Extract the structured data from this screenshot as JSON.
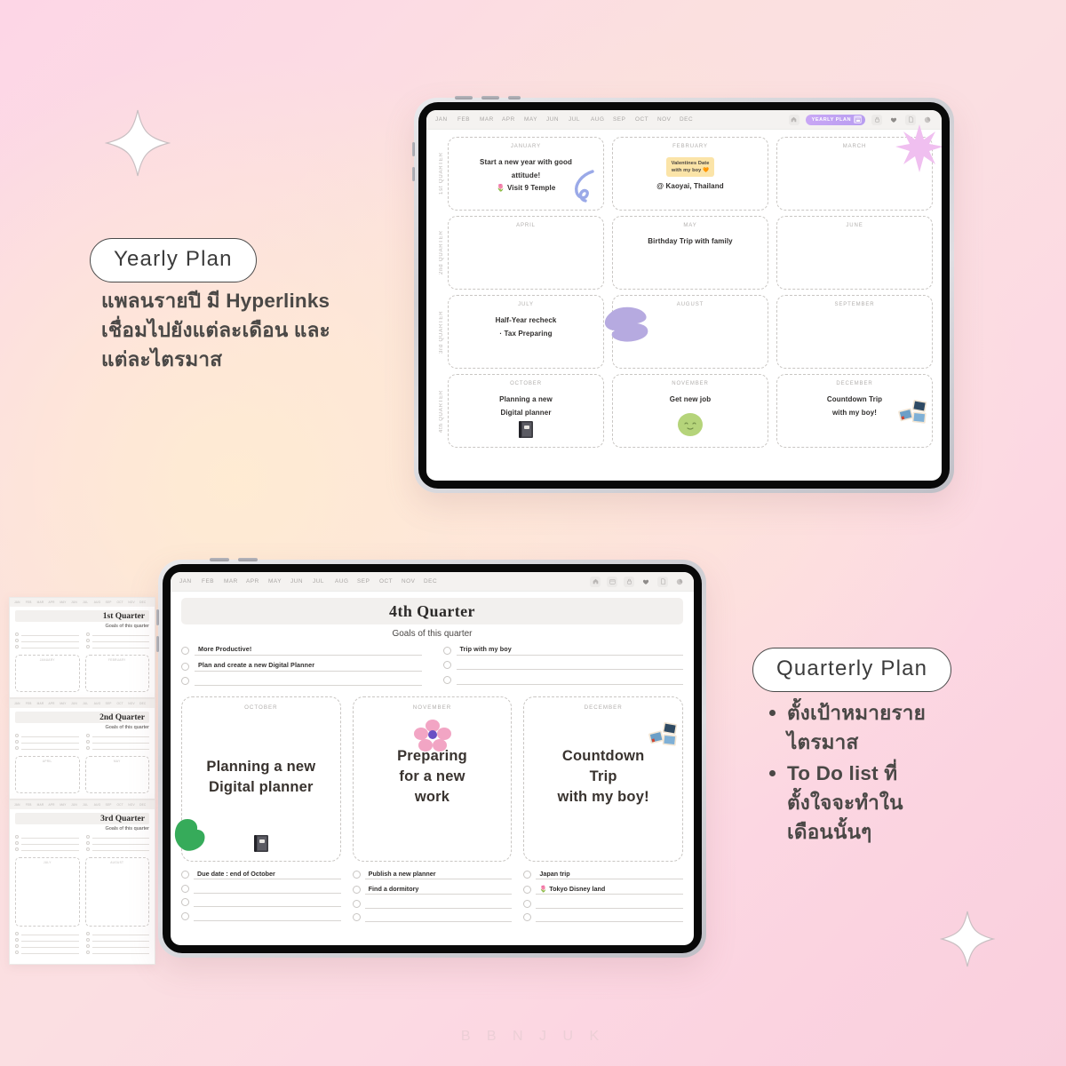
{
  "brand": {
    "footer": "B B N J U K"
  },
  "callouts": {
    "yearly": {
      "pill": "Yearly Plan",
      "line1": "แพลนรายปี มี Hyperlinks",
      "line2": "เชื่อมไปยังแต่ละเดือน และ",
      "line3": "แต่ละไตรมาส"
    },
    "quarterly": {
      "pill": "Quarterly Plan",
      "bullets": [
        "ตั้งเป้าหมายราย ไตรมาส",
        "To Do list ที่ ตั้งใจจะทำใน เดือนนั้นๆ"
      ],
      "bullet1_l1": "ตั้งเป้าหมายราย",
      "bullet1_l2": "ไตรมาส",
      "bullet2_l1": "To Do list ที่",
      "bullet2_l2": "ตั้งใจจะทำใน",
      "bullet2_l3": "เดือนนั้นๆ"
    }
  },
  "toolbar": {
    "months": [
      "JAN",
      "FEB",
      "MAR",
      "APR",
      "MAY",
      "JUN",
      "JUL",
      "AUG",
      "SEP",
      "OCT",
      "NOV",
      "DEC"
    ],
    "plan_pill_label": "YEARLY PLAN",
    "icons": [
      "home-icon",
      "calendar-icon",
      "lock-icon",
      "heart-icon",
      "note-icon",
      "pen-icon"
    ],
    "accent_purple": "#bb9cf0"
  },
  "yearly_page": {
    "quarters": [
      {
        "label": "1st QUARTER",
        "months": [
          {
            "name": "JANUARY",
            "line1": "Start a new year with good",
            "line2": "attitude!",
            "line3": "🌷 Visit 9 Temple",
            "sticker": "blue-squiggle"
          },
          {
            "name": "FEBRUARY",
            "sticky": "Valentines Date\nwith my boy 🧡",
            "place": "@ Kaoyai, Thailand"
          },
          {
            "name": "MARCH",
            "sticker": "pink-star"
          }
        ]
      },
      {
        "label": "2nd QUARTER",
        "months": [
          {
            "name": "APRIL"
          },
          {
            "name": "MAY",
            "line1": "Birthday Trip with family"
          },
          {
            "name": "JUNE"
          }
        ]
      },
      {
        "label": "3rd QUARTER",
        "months": [
          {
            "name": "JULY",
            "line1": "Half-Year recheck",
            "line2": "·  Tax Preparing"
          },
          {
            "name": "AUGUST",
            "sticker": "purple-blob"
          },
          {
            "name": "SEPTEMBER"
          }
        ]
      },
      {
        "label": "4th QUARTER",
        "months": [
          {
            "name": "OCTOBER",
            "line1": "Planning a new",
            "line2": "Digital planner",
            "sticker": "notebook-emoji"
          },
          {
            "name": "NOVEMBER",
            "line1": "Get new job",
            "sticker": "green-face"
          },
          {
            "name": "DECEMBER",
            "line1": "Countdown Trip",
            "line2": "with my boy!",
            "sticker": "photos-emoji"
          }
        ]
      }
    ]
  },
  "quarterly_page": {
    "title": "4th Quarter",
    "subtitle": "Goals of this quarter",
    "goals_left": [
      "More Productive!",
      "Plan and create a new Digital Planner",
      ""
    ],
    "goals_right": [
      "Trip with my boy",
      "",
      ""
    ],
    "months": [
      {
        "name": "OCTOBER",
        "text_lines": [
          "Planning a new",
          "Digital planner"
        ],
        "stickers": [
          "green-blob",
          "notebook-emoji"
        ],
        "todos": [
          "Due date : end of October",
          "",
          "",
          ""
        ]
      },
      {
        "name": "NOVEMBER",
        "text_lines": [
          "Preparing",
          "for a new",
          "work"
        ],
        "stickers": [
          "pink-flower"
        ],
        "todos": [
          "Publish a new planner",
          "Find a dormitory",
          "",
          ""
        ]
      },
      {
        "name": "DECEMBER",
        "text_lines": [
          "Countdown",
          "Trip",
          "with my boy!"
        ],
        "stickers": [
          "photos-emoji"
        ],
        "todos": [
          "Japan trip",
          "🌷 Tokyo Disney land",
          "",
          ""
        ]
      }
    ]
  },
  "background_sheets": [
    {
      "title": "1st Quarter",
      "subtitle": "Goals of this quarter",
      "boxes": [
        "JANUARY",
        "FEBRUARY"
      ]
    },
    {
      "title": "2nd Quarter",
      "subtitle": "Goals of this quarter",
      "boxes": [
        "APRIL",
        "MAY"
      ]
    },
    {
      "title": "3rd Quarter",
      "subtitle": "Goals of this quarter",
      "boxes": [
        "JULY",
        "AUGUST"
      ]
    }
  ]
}
